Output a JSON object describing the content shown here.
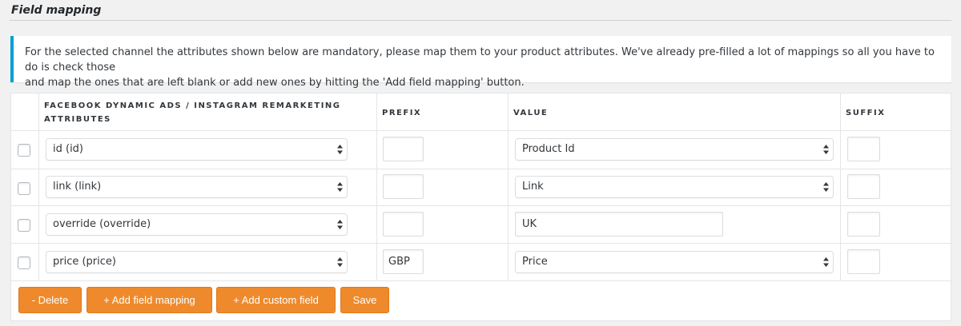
{
  "section": {
    "title": "Field mapping",
    "notice_line1": "For the selected channel the attributes shown below are mandatory, please map them to your product attributes. We've already pre-filled a lot of mappings so all you have to do is check those",
    "notice_line2": "and map the ones that are left blank or add new ones by hitting the 'Add field mapping' button."
  },
  "table": {
    "headers": {
      "attribute_line1": "Facebook Dynamic Ads / Instagram Remarketing",
      "attribute_line2": "Attributes",
      "prefix": "Prefix",
      "value": "Value",
      "suffix": "Suffix"
    },
    "rows": [
      {
        "attribute": "id (id)",
        "prefix": "",
        "value": "Product Id",
        "value_type": "select",
        "suffix": ""
      },
      {
        "attribute": "link (link)",
        "prefix": "",
        "value": "Link",
        "value_type": "select",
        "suffix": ""
      },
      {
        "attribute": "override (override)",
        "prefix": "",
        "value": "UK",
        "value_type": "text",
        "suffix": ""
      },
      {
        "attribute": "price (price)",
        "prefix": "GBP",
        "value": "Price",
        "value_type": "select",
        "suffix": ""
      }
    ]
  },
  "buttons": {
    "delete": "- Delete",
    "add_field_mapping": "+ Add field mapping",
    "add_custom_field": "+ Add custom field",
    "save": "Save"
  },
  "colors": {
    "accent_orange": "#ef8a2c",
    "notice_border": "#00a0d2"
  },
  "icons": {
    "select_arrows": "updown-arrows-icon"
  }
}
